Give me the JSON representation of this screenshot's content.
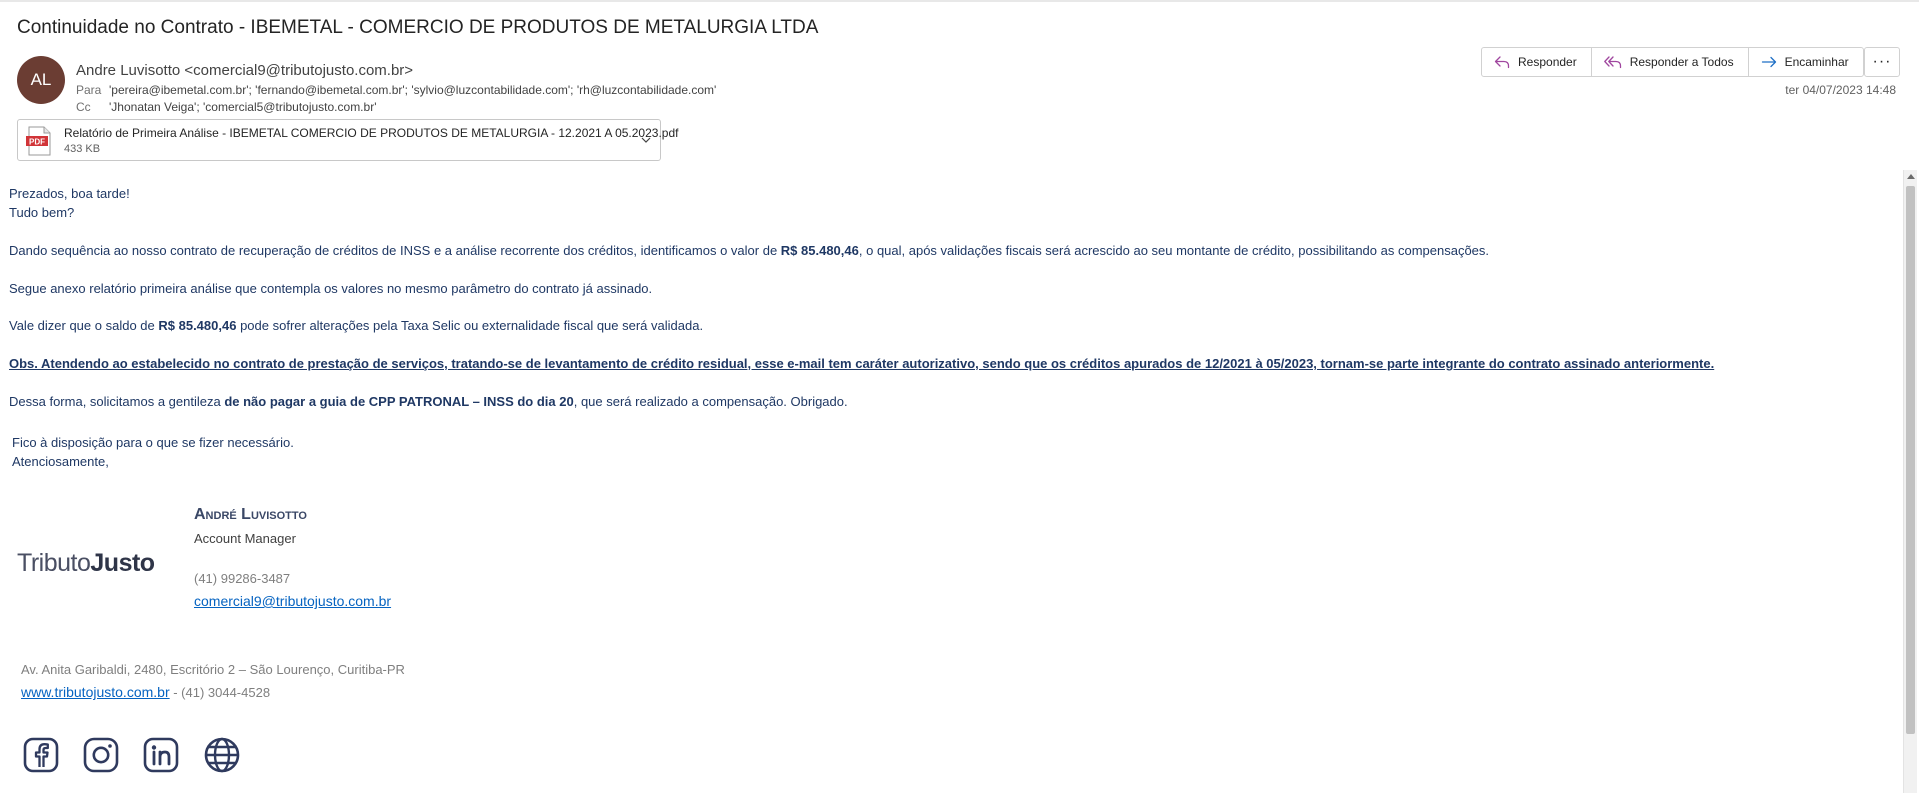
{
  "email": {
    "subject": "Continuidade no Contrato - IBEMETAL - COMERCIO DE PRODUTOS DE METALURGIA LTDA",
    "avatar_initials": "AL",
    "avatar_color": "#6b3d33",
    "sender": "Andre Luvisotto <comercial9@tributojusto.com.br>",
    "to_label": "Para",
    "to": "'pereira@ibemetal.com.br'; 'fernando@ibemetal.com.br'; 'sylvio@luzcontabilidade.com'; 'rh@luzcontabilidade.com'",
    "cc_label": "Cc",
    "cc": "'Jhonatan Veiga'; 'comercial5@tributojusto.com.br'",
    "date": "ter 04/07/2023 14:48"
  },
  "actions": {
    "reply": "Responder",
    "reply_all": "Responder a Todos",
    "forward": "Encaminhar",
    "more": "···"
  },
  "attachment": {
    "name": "Relatório de Primeira Análise - IBEMETAL COMERCIO DE PRODUTOS DE METALURGIA - 12.2021 A 05.2023.pdf",
    "size": "433 KB",
    "icon_text": "PDF"
  },
  "body": {
    "greeting": "Prezados, boa tarde!",
    "greeting2": "Tudo bem?",
    "p1_a": "Dando sequência ao nosso contrato de recuperação de créditos de INSS e a análise recorrente dos créditos, identificamos o valor de ",
    "p1_amount": "R$ 85.480,46",
    "p1_b": ", o qual, após validações fiscais será acrescido ao seu montante de crédito, possibilitando as compensações.",
    "p2": "Segue anexo relatório primeira análise que contempla os valores no mesmo parâmetro do contrato já assinado.",
    "p3_a": "Vale dizer que o saldo de ",
    "p3_amount": "R$ 85.480,46",
    "p3_b": " pode sofrer alterações pela Taxa Selic ou externalidade fiscal que será validada.",
    "obs": "Obs. Atendendo ao estabelecido no contrato de prestação de serviços, tratando-se de levantamento de crédito residual, esse e-mail tem caráter autorizativo, sendo que os créditos apurados de 12/2021 à 05/2023, tornam-se parte integrante do contrato assinado anteriormente.",
    "p4_a": "Dessa forma, solicitamos a gentileza ",
    "p4_bold": "de não pagar a guia de CPP PATRONAL – INSS do dia 20",
    "p4_b": ", que será realizado a compensação. Obrigado.",
    "closing1": "Fico à disposição para o que se fizer necessário.",
    "closing2": "Atenciosamente,"
  },
  "signature": {
    "logo_part1": "Tributo",
    "logo_part2": "Justo",
    "name": "André Luvisotto",
    "role": "Account Manager",
    "phone": "(41) 99286-3487",
    "email": "comercial9@tributojusto.com.br",
    "address": "Av. Anita Garibaldi, 2480, Escritório 2 – São Lourenço, Curitiba-PR",
    "website": "www.tributojusto.com.br",
    "website_suffix": " - (41) 3044-4528",
    "social_icons": [
      "facebook-icon",
      "instagram-icon",
      "linkedin-icon",
      "globe-icon"
    ]
  }
}
